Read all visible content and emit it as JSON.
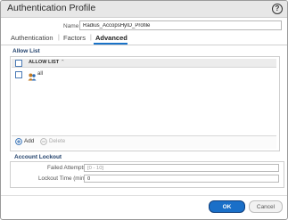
{
  "dialog": {
    "title": "Authentication Profile",
    "help_glyph": "?"
  },
  "name": {
    "label": "Name",
    "value": "Radius_AccopsHyID_Profile"
  },
  "tabs": [
    {
      "label": "Authentication",
      "active": false
    },
    {
      "label": "Factors",
      "active": false
    },
    {
      "label": "Advanced",
      "active": true
    }
  ],
  "allow_list": {
    "section_label": "Allow List",
    "column_header": "ALLOW LIST",
    "sort_icon": "chevron-up-icon",
    "rows": [
      {
        "icon": "users-icon",
        "text": "all"
      }
    ],
    "add_label": "Add",
    "delete_label": "Delete"
  },
  "lockout": {
    "section_label": "Account Lockout",
    "failed_attempts_label": "Failed Attempts",
    "failed_attempts_placeholder": "[0 - 10]",
    "lockout_time_label": "Lockout Time (min)",
    "lockout_time_value": "0"
  },
  "buttons": {
    "ok": "OK",
    "cancel": "Cancel"
  },
  "colors": {
    "accent": "#1a6fc8",
    "section": "#1f3f6a"
  }
}
